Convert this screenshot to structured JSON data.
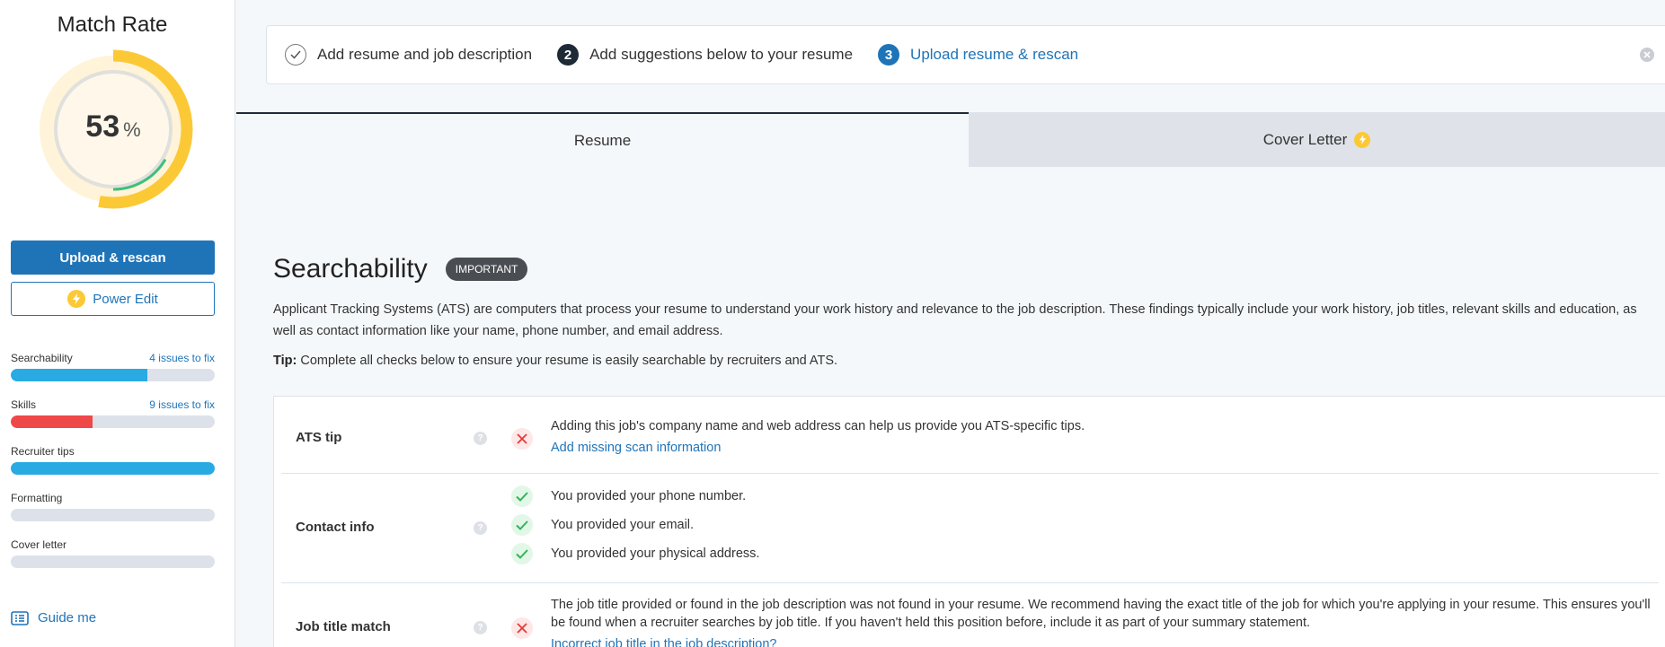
{
  "sidebar": {
    "title": "Match Rate",
    "match_rate": 53,
    "match_rate_unit": "%",
    "upload_button": "Upload & rescan",
    "power_edit_button": "Power Edit",
    "metrics": [
      {
        "label": "Searchability",
        "issues": "4 issues to fix",
        "fill": 0.67,
        "color": "#29aae3"
      },
      {
        "label": "Skills",
        "issues": "9 issues to fix",
        "fill": 0.4,
        "color": "#ef4848"
      },
      {
        "label": "Recruiter tips",
        "issues": "",
        "fill": 1.0,
        "color": "#29aae3"
      },
      {
        "label": "Formatting",
        "issues": "",
        "fill": 0,
        "color": "#29aae3"
      },
      {
        "label": "Cover letter",
        "issues": "",
        "fill": 0,
        "color": "#29aae3"
      }
    ],
    "guide_me": "Guide me"
  },
  "steps": [
    {
      "number": "",
      "label": "Add resume and job description"
    },
    {
      "number": "2",
      "label": "Add suggestions below to your resume"
    },
    {
      "number": "3",
      "label": "Upload resume & rescan"
    }
  ],
  "tabs": {
    "resume": "Resume",
    "cover_letter": "Cover Letter"
  },
  "section": {
    "title": "Searchability",
    "badge": "IMPORTANT",
    "description": "Applicant Tracking Systems (ATS) are computers that process your resume to understand your work history and relevance to the job description. These findings typically include your work history, job titles, relevant skills and education, as well as contact information like your name, phone number, and email address.",
    "tip_label": "Tip:",
    "tip_text": "Complete all checks below to ensure your resume is easily searchable by recruiters and ATS."
  },
  "checks": {
    "ats": {
      "label": "ATS tip",
      "text": "Adding this job's company name and web address can help us provide you ATS-specific tips.",
      "link": "Add missing scan information"
    },
    "contact": {
      "label": "Contact info",
      "items": [
        "You provided your phone number.",
        "You provided your email.",
        "You provided your physical address."
      ]
    },
    "jobtitle": {
      "label": "Job title match",
      "text": "The job title provided or found in the job description was not found in your resume. We recommend having the exact title of the job for which you're applying in your resume. This ensures you'll be found when a recruiter searches by job title. If you haven't held this position before, include it as part of your summary statement.",
      "link": "Incorrect job title in the job description?"
    }
  },
  "colors": {
    "primary": "#1f74b8",
    "step2": "#1e2a36",
    "step3": "#1f74b8",
    "gauge_yellow": "#fcc936",
    "gauge_green": "#3cc07a"
  }
}
